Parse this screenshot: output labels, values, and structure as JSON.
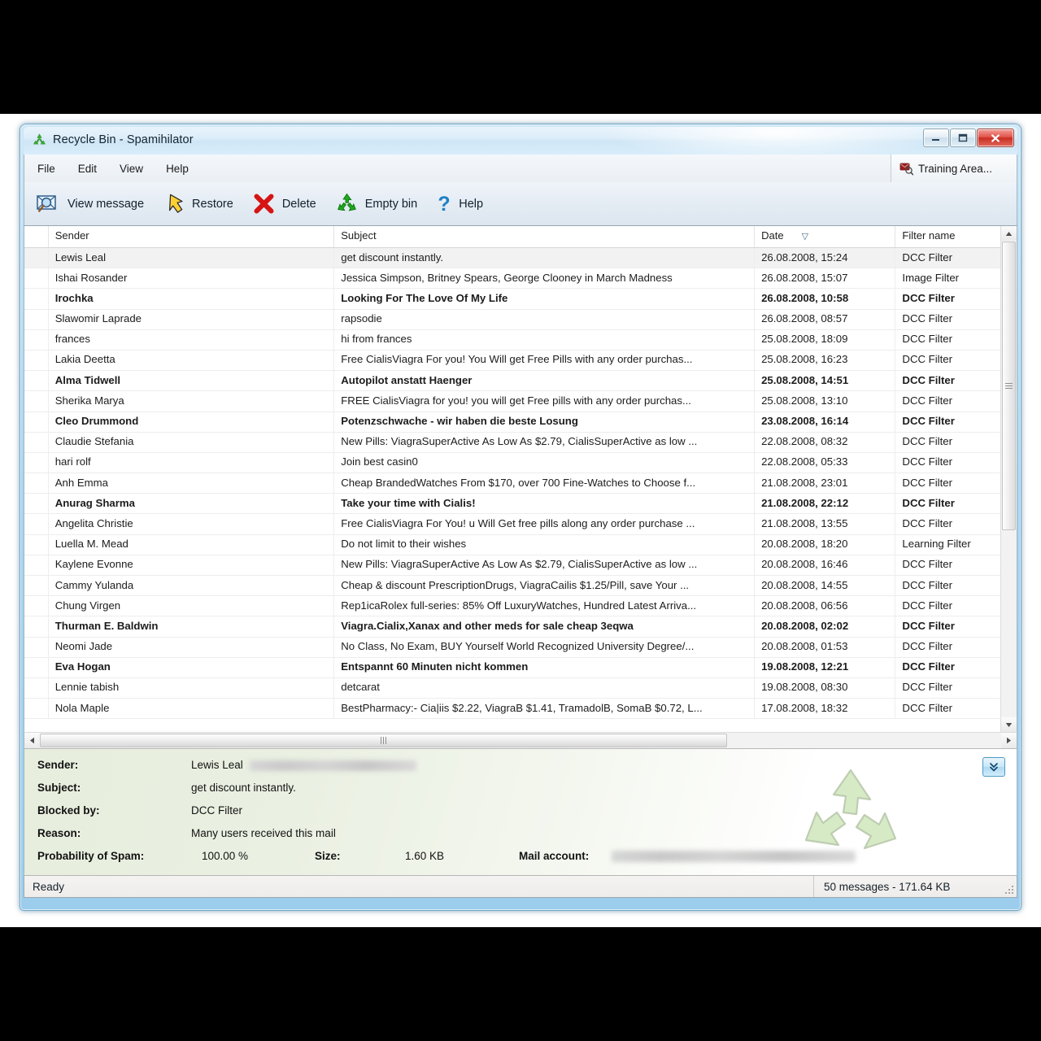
{
  "window": {
    "title": "Recycle Bin - Spamihilator",
    "icon": "recycle-icon",
    "minimize_label": "Minimize",
    "maximize_label": "Maximize",
    "close_label": "Close"
  },
  "menu": {
    "items": [
      {
        "label": "File"
      },
      {
        "label": "Edit"
      },
      {
        "label": "View"
      },
      {
        "label": "Help"
      }
    ],
    "training_button": {
      "label": "Training Area...",
      "icon": "training-area-icon"
    }
  },
  "toolbar": {
    "buttons": [
      {
        "label": "View message",
        "icon": "view-message-icon"
      },
      {
        "label": "Restore",
        "icon": "restore-arrow-icon"
      },
      {
        "label": "Delete",
        "icon": "delete-x-icon"
      },
      {
        "label": "Empty bin",
        "icon": "empty-bin-recycle-icon"
      },
      {
        "label": "Help",
        "icon": "help-question-icon"
      }
    ]
  },
  "list": {
    "columns": [
      {
        "key": "sender",
        "label": "Sender"
      },
      {
        "key": "subject",
        "label": "Subject"
      },
      {
        "key": "date",
        "label": "Date",
        "sorted": true,
        "sort_glyph": "▽"
      },
      {
        "key": "filter",
        "label": "Filter name"
      }
    ],
    "rows": [
      {
        "sender": "Lewis Leal",
        "subject": "get discount instantly.",
        "date": "26.08.2008, 15:24",
        "filter": "DCC Filter",
        "unread": false,
        "selected": true
      },
      {
        "sender": "Ishai Rosander",
        "subject": "Jessica Simpson, Britney Spears, George Clooney in March Madness",
        "date": "26.08.2008, 15:07",
        "filter": "Image Filter",
        "unread": false,
        "selected": false
      },
      {
        "sender": "Irochka",
        "subject": "Looking For The Love Of My Life",
        "date": "26.08.2008, 10:58",
        "filter": "DCC Filter",
        "unread": true,
        "selected": false
      },
      {
        "sender": "Slawomir Laprade",
        "subject": "rapsodie",
        "date": "26.08.2008, 08:57",
        "filter": "DCC Filter",
        "unread": false,
        "selected": false
      },
      {
        "sender": "frances",
        "subject": "hi from frances",
        "date": "25.08.2008, 18:09",
        "filter": "DCC Filter",
        "unread": false,
        "selected": false
      },
      {
        "sender": "Lakia Deetta",
        "subject": "Free CialisViagra For you! You Will get Free Pills with any order purchas...",
        "date": "25.08.2008, 16:23",
        "filter": "DCC Filter",
        "unread": false,
        "selected": false
      },
      {
        "sender": "Alma Tidwell",
        "subject": "Autopilot anstatt Haenger",
        "date": "25.08.2008, 14:51",
        "filter": "DCC Filter",
        "unread": true,
        "selected": false
      },
      {
        "sender": "Sherika Marya",
        "subject": "FREE CialisViagra for you! you will get Free pills with any order purchas...",
        "date": "25.08.2008, 13:10",
        "filter": "DCC Filter",
        "unread": false,
        "selected": false
      },
      {
        "sender": "Cleo Drummond",
        "subject": "Potenzschwache - wir haben die beste Losung",
        "date": "23.08.2008, 16:14",
        "filter": "DCC Filter",
        "unread": true,
        "selected": false
      },
      {
        "sender": "Claudie Stefania",
        "subject": "New Pills: ViagraSuperActive As Low As $2.79, CialisSuperActive as low ...",
        "date": "22.08.2008, 08:32",
        "filter": "DCC Filter",
        "unread": false,
        "selected": false
      },
      {
        "sender": "hari rolf",
        "subject": "Join best casin0",
        "date": "22.08.2008, 05:33",
        "filter": "DCC Filter",
        "unread": false,
        "selected": false
      },
      {
        "sender": "Anh Emma",
        "subject": "Cheap BrandedWatches From $170, over 700 Fine-Watches to Choose f...",
        "date": "21.08.2008, 23:01",
        "filter": "DCC Filter",
        "unread": false,
        "selected": false
      },
      {
        "sender": "Anurag Sharma",
        "subject": "Take your time with Cialis!",
        "date": "21.08.2008, 22:12",
        "filter": "DCC Filter",
        "unread": true,
        "selected": false
      },
      {
        "sender": "Angelita Christie",
        "subject": "Free CialisViagra For You! u Will Get free pills along any order purchase ...",
        "date": "21.08.2008, 13:55",
        "filter": "DCC Filter",
        "unread": false,
        "selected": false
      },
      {
        "sender": "Luella M. Mead",
        "subject": "Do not limit to their wishes",
        "date": "20.08.2008, 18:20",
        "filter": "Learning Filter",
        "unread": false,
        "selected": false
      },
      {
        "sender": "Kaylene Evonne",
        "subject": "New Pills: ViagraSuperActive As Low As $2.79, CialisSuperActive as low ...",
        "date": "20.08.2008, 16:46",
        "filter": "DCC Filter",
        "unread": false,
        "selected": false
      },
      {
        "sender": "Cammy Yulanda",
        "subject": "Cheap & discount PrescriptionDrugs, ViagraCailis $1.25/Pill, save Your ...",
        "date": "20.08.2008, 14:55",
        "filter": "DCC Filter",
        "unread": false,
        "selected": false
      },
      {
        "sender": "Chung Virgen",
        "subject": "Rep1icaRolex full-series: 85% Off LuxuryWatches, Hundred Latest Arriva...",
        "date": "20.08.2008, 06:56",
        "filter": "DCC Filter",
        "unread": false,
        "selected": false
      },
      {
        "sender": "Thurman E. Baldwin",
        "subject": "Viagra.Cialix,Xanax and other meds for sale cheap    3eqwa",
        "date": "20.08.2008, 02:02",
        "filter": "DCC Filter",
        "unread": true,
        "selected": false
      },
      {
        "sender": "Neomi Jade",
        "subject": "No Class, No Exam, BUY Yourself World Recognized University Degree/...",
        "date": "20.08.2008, 01:53",
        "filter": "DCC Filter",
        "unread": false,
        "selected": false
      },
      {
        "sender": "Eva Hogan",
        "subject": "Entspannt 60 Minuten nicht kommen",
        "date": "19.08.2008, 12:21",
        "filter": "DCC Filter",
        "unread": true,
        "selected": false
      },
      {
        "sender": "Lennie tabish",
        "subject": "detcarat",
        "date": "19.08.2008, 08:30",
        "filter": "DCC Filter",
        "unread": false,
        "selected": false
      },
      {
        "sender": "Nola Maple",
        "subject": "BestPharmacy:- Cia|iis $2.22, ViagraB $1.41, TramadolB, SomaB $0.72, L...",
        "date": "17.08.2008, 18:32",
        "filter": "DCC Filter",
        "unread": false,
        "selected": false
      }
    ]
  },
  "details": {
    "sender_label": "Sender:",
    "sender_value": "Lewis Leal",
    "sender_email_redacted": true,
    "subject_label": "Subject:",
    "subject_value": "get discount instantly.",
    "blocked_label": "Blocked by:",
    "blocked_value": "DCC Filter",
    "reason_label": "Reason:",
    "reason_value": "Many users received this mail",
    "probability_label": "Probability of Spam:",
    "probability_value": "100.00 %",
    "size_label": "Size:",
    "size_value": "1.60 KB",
    "account_label": "Mail account:",
    "account_value_redacted": true,
    "expand_button": "expand-details-button",
    "watermark": "recycle-watermark-icon"
  },
  "status": {
    "left": "Ready",
    "right": "50 messages - 171.64 KB"
  },
  "colors": {
    "accent": "#9ccdec",
    "close_red": "#c92e23",
    "recycle_green": "#2aa02a",
    "details_bg": "#eaf0e2"
  }
}
